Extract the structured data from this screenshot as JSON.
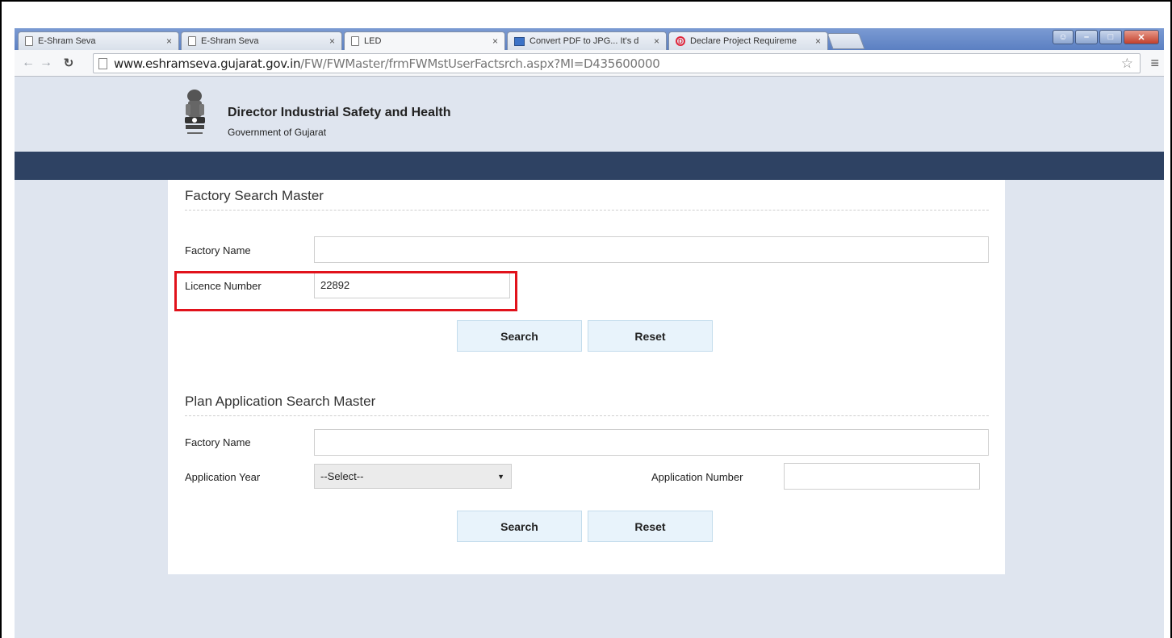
{
  "browser": {
    "tabs": [
      {
        "label": "E-Shram Seva",
        "icon": "page-icon",
        "active": false
      },
      {
        "label": "E-Shram Seva",
        "icon": "page-icon",
        "active": false
      },
      {
        "label": "LED",
        "icon": "page-icon",
        "active": true
      },
      {
        "label": "Convert PDF to JPG... It's d",
        "icon": "image-icon",
        "active": false
      },
      {
        "label": "Declare Project Requireme",
        "icon": "declare-icon",
        "active": false
      }
    ],
    "close_glyph": "×",
    "url_host": "www.eshramseva.gujarat.gov.in",
    "url_path": "/FW/FWMaster/frmFWMstUserFactsrch.aspx?MI=D435600000"
  },
  "header": {
    "title": "Director Industrial Safety and Health",
    "subtitle": "Government of Gujarat"
  },
  "factory_search": {
    "title": "Factory Search Master",
    "factory_name_label": "Factory Name",
    "factory_name_value": "",
    "licence_label": "Licence Number",
    "licence_value": "22892",
    "search_label": "Search",
    "reset_label": "Reset"
  },
  "plan_search": {
    "title": "Plan Application Search Master",
    "factory_name_label": "Factory Name",
    "factory_name_value": "",
    "year_label": "Application Year",
    "year_selected": "--Select--",
    "app_number_label": "Application Number",
    "app_number_value": "",
    "search_label": "Search",
    "reset_label": "Reset"
  },
  "colors": {
    "nav_band": "#2e4263",
    "page_bg": "#dfe5ef",
    "button_bg": "#e8f3fb",
    "highlight": "#e1121b"
  }
}
